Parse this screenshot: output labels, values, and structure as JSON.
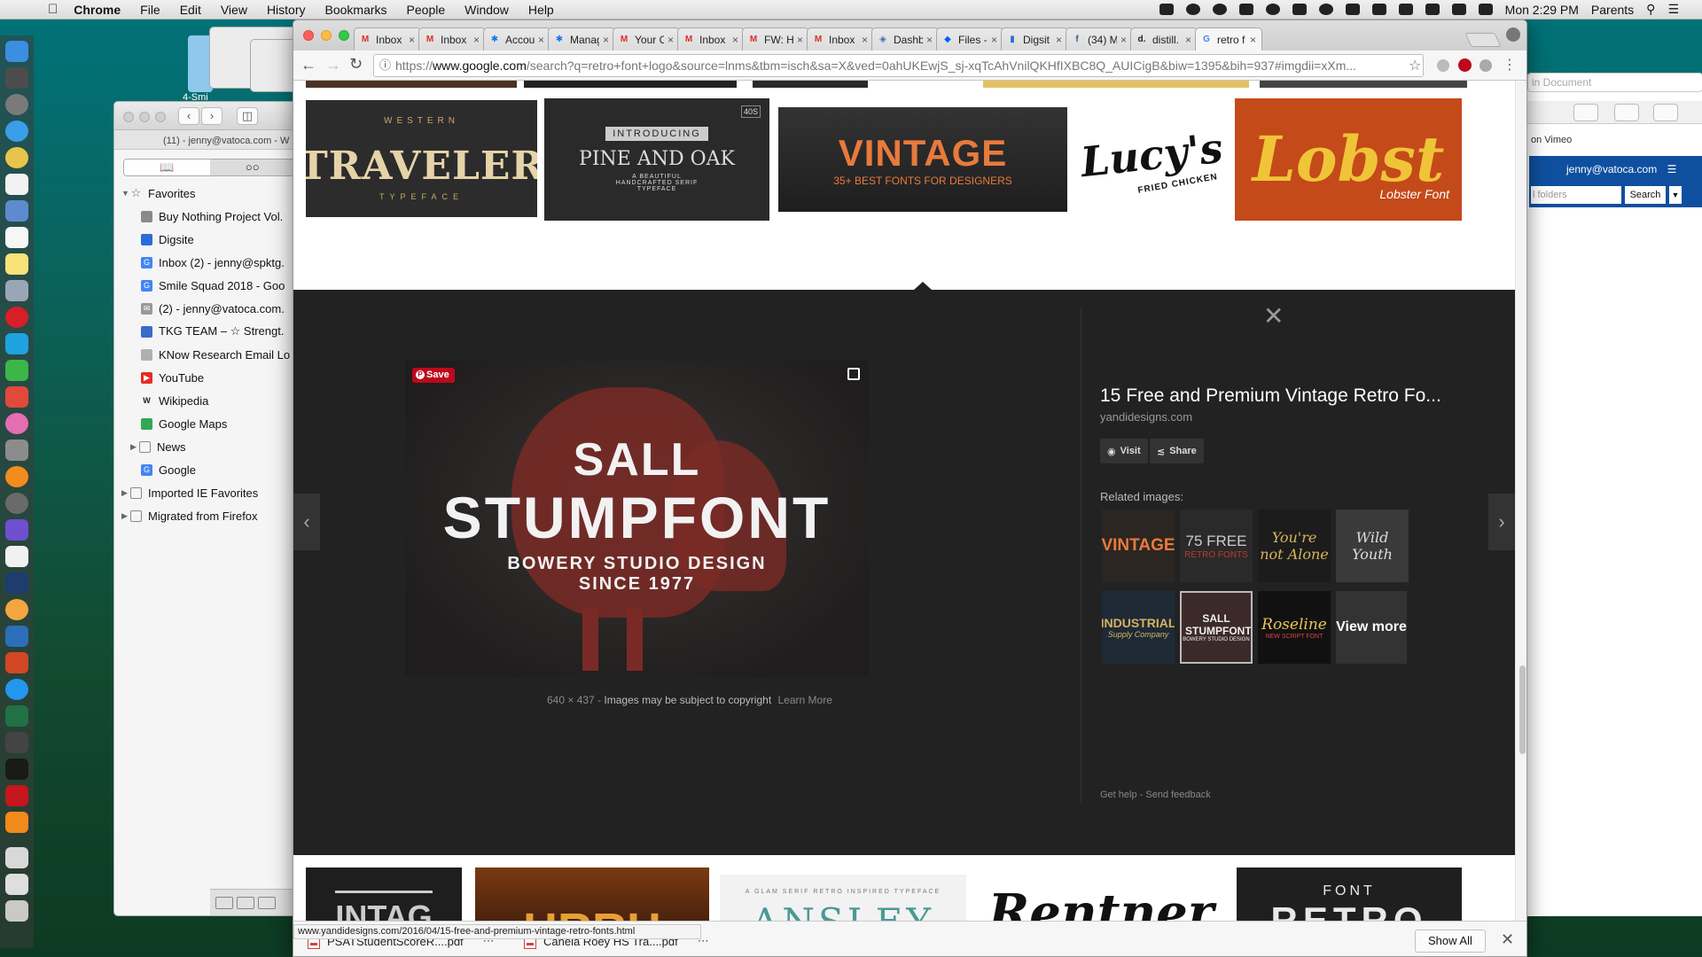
{
  "menubar": {
    "app": "Chrome",
    "items": [
      "File",
      "Edit",
      "View",
      "History",
      "Bookmarks",
      "People",
      "Window",
      "Help"
    ],
    "clock": "Mon 2:29 PM",
    "user": "Parents"
  },
  "desktop": {
    "icon_label": "4-Smi"
  },
  "safari": {
    "window_title": "(11) - jenny@vatoca.com - W",
    "favorites_header": "Favorites",
    "favorites": [
      {
        "label": "Buy Nothing Project Vol.",
        "icon": "book-icon"
      },
      {
        "label": "Digsite",
        "icon": "digsite-icon"
      },
      {
        "label": "Inbox (2) - jenny@spktg.",
        "icon": "google-icon"
      },
      {
        "label": "Smile Squad 2018 - Goo",
        "icon": "google-icon"
      },
      {
        "label": "(2) - jenny@vatoca.com.",
        "icon": "mail-icon"
      },
      {
        "label": "TKG TEAM – ☆ Strengt.",
        "icon": "team-icon"
      },
      {
        "label": "KNow Research Email Lo",
        "icon": "document-icon"
      },
      {
        "label": "YouTube",
        "icon": "youtube-icon"
      },
      {
        "label": "Wikipedia",
        "icon": "wikipedia-icon"
      },
      {
        "label": "Google Maps",
        "icon": "maps-icon"
      },
      {
        "label": "News",
        "icon": "folder-icon"
      },
      {
        "label": "Google",
        "icon": "google-icon"
      }
    ],
    "imported_ie": "Imported IE Favorites",
    "migrated_firefox": "Migrated from Firefox"
  },
  "rightwin": {
    "search_placeholder": "in Document",
    "vimeo": "on Vimeo",
    "account": "jenny@vatoca.com",
    "folders_placeholder": "l folders",
    "search_btn": "Search"
  },
  "chrome": {
    "tabs": [
      {
        "label": "Inbox",
        "icon": "gmail-icon",
        "color": "#d93025"
      },
      {
        "label": "Inbox",
        "icon": "gmail-icon",
        "color": "#d93025"
      },
      {
        "label": "Accou",
        "icon": "gear-icon",
        "color": "#1a73e8"
      },
      {
        "label": "Manag",
        "icon": "gear-icon",
        "color": "#1a73e8"
      },
      {
        "label": "Your C",
        "icon": "gmail-icon",
        "color": "#d93025"
      },
      {
        "label": "Inbox",
        "icon": "gmail-icon",
        "color": "#d93025"
      },
      {
        "label": "FW: H",
        "icon": "gmail-icon",
        "color": "#d93025"
      },
      {
        "label": "Inbox",
        "icon": "gmail-icon",
        "color": "#d93025"
      },
      {
        "label": "Dashb",
        "icon": "shield-icon",
        "color": "#3b6fb6"
      },
      {
        "label": "Files -",
        "icon": "dropbox-icon",
        "color": "#0061ff"
      },
      {
        "label": "Digsit",
        "icon": "digsite-icon",
        "color": "#2a6dd8"
      },
      {
        "label": "(34) M",
        "icon": "facebook-icon",
        "color": "#3b5998"
      },
      {
        "label": "distill.",
        "icon": "distill-icon",
        "color": "#222222"
      },
      {
        "label": "retro f",
        "icon": "google-icon",
        "color": "#4285f4"
      }
    ],
    "url_prefix": "https://",
    "url_host": "www.google.com",
    "url_rest": "/search?q=retro+font+logo&source=lnms&tbm=isch&sa=X&ved=0ahUKEwjS_sj-xqTcAhVnilQKHfIXBC8Q_AUICigB&biw=1395&bih=937#imgdii=xXm..."
  },
  "results_top": [
    {
      "title": "TRAVELER",
      "top": "WESTERN",
      "bottom": "TYPEFACE"
    },
    {
      "title": "PINE AND OAK",
      "top": "INTRODUCING",
      "bottom": "A BEAUTIFUL HANDCRAFTED SERIF TYPEFACE",
      "badge": "40S"
    },
    {
      "title": "VINTAGE",
      "subtitle": "35+ BEST FONTS FOR DESIGNERS"
    },
    {
      "title": "Lucy's",
      "subtitle": "FRIED CHICKEN"
    },
    {
      "title": "Lobst",
      "subtitle": "Lobster Font"
    }
  ],
  "results_bottom": [
    {
      "title": "INTAG"
    },
    {
      "title": "HRRH"
    },
    {
      "title": "ANSLEY",
      "subtitle": "A GLAM SERIF RETRO INSPIRED TYPEFACE"
    },
    {
      "title": "Rentner"
    },
    {
      "title": "RETRO",
      "top": "FONT"
    }
  ],
  "panel": {
    "save_label": "Save",
    "image": {
      "line1": "SALL",
      "line2": "STUMPFONT",
      "line3": "BOWERY STUDIO DESIGN",
      "line4": "SINCE 1977"
    },
    "dims": "640 × 437",
    "copyright": "Images may be subject to copyright",
    "learn_more": "Learn More",
    "title": "15 Free and Premium Vintage Retro Fo...",
    "domain": "yandidesigns.com",
    "visit": "Visit",
    "share": "Share",
    "related_header": "Related images:",
    "related": [
      {
        "text": "VINTAGE",
        "sub": ""
      },
      {
        "text": "75 FREE",
        "sub": "RETRO FONTS"
      },
      {
        "text": "You're not Alone",
        "sub": ""
      },
      {
        "text": "Wild Youth",
        "sub": ""
      },
      {
        "text": "INDUSTRIAL",
        "sub": "Supply Company"
      },
      {
        "text": "SALL STUMPFONT",
        "sub": "BOWERY STUDIO DESIGN"
      },
      {
        "text": "Roseline",
        "sub": "NEW SCRIPT FONT"
      },
      {
        "text": "View more",
        "sub": ""
      }
    ],
    "get_help": "Get help",
    "send_feedback": "Send feedback"
  },
  "status_url": "www.yandidesigns.com/2016/04/15-free-and-premium-vintage-retro-fonts.html",
  "downloads": [
    {
      "name": "PSATStudentScoreR....pdf"
    },
    {
      "name": "Canela Roey HS Tra....pdf"
    }
  ],
  "show_all": "Show All"
}
